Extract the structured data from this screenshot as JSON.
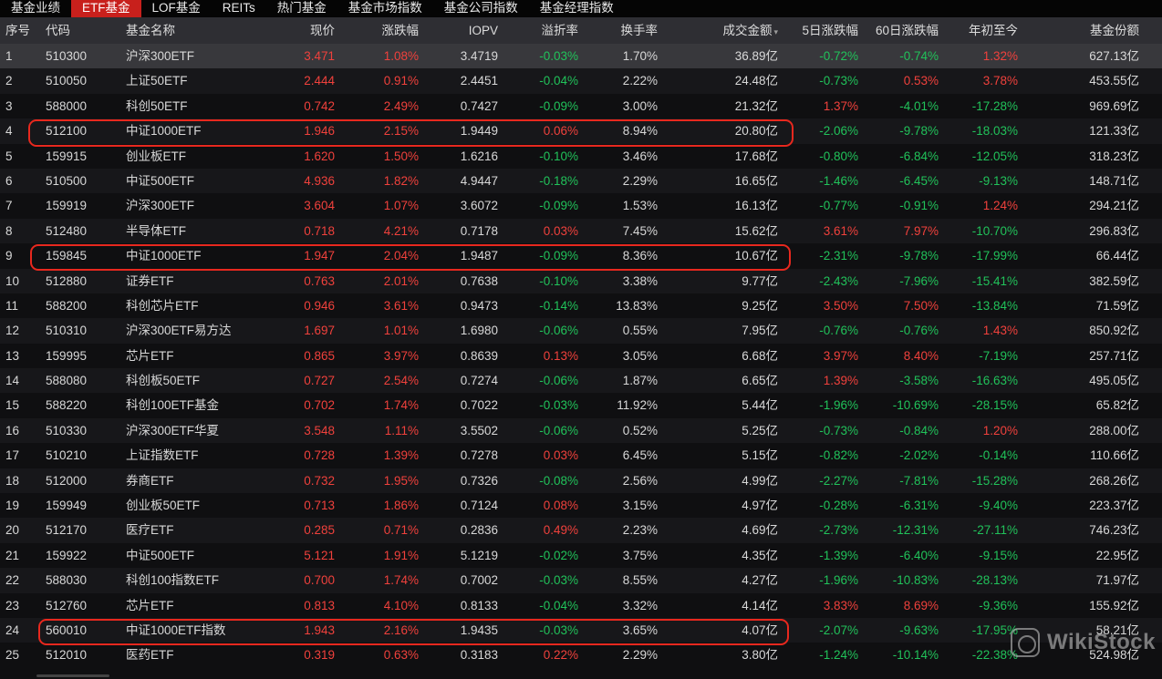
{
  "tabs": [
    "基金业绩",
    "ETF基金",
    "LOF基金",
    "REITs",
    "热门基金",
    "基金市场指数",
    "基金公司指数",
    "基金经理指数"
  ],
  "active_tab": 1,
  "columns": {
    "idx": "序号",
    "code": "代码",
    "name": "基金名称",
    "price": "现价",
    "chg": "涨跌幅",
    "iopv": "IOPV",
    "prem": "溢折率",
    "turn": "换手率",
    "amt": "成交金额",
    "d5": "5日涨跌幅",
    "d60": "60日涨跌幅",
    "ytd": "年初至今",
    "shr": "基金份额"
  },
  "rows": [
    [
      "1",
      "510300",
      "沪深300ETF",
      "3.471",
      "1.08%",
      "3.4719",
      "-0.03%",
      "1.70%",
      "36.89亿",
      "-0.72%",
      "-0.74%",
      "1.32%",
      "627.13亿"
    ],
    [
      "2",
      "510050",
      "上证50ETF",
      "2.444",
      "0.91%",
      "2.4451",
      "-0.04%",
      "2.22%",
      "24.48亿",
      "-0.73%",
      "0.53%",
      "3.78%",
      "453.55亿"
    ],
    [
      "3",
      "588000",
      "科创50ETF",
      "0.742",
      "2.49%",
      "0.7427",
      "-0.09%",
      "3.00%",
      "21.32亿",
      "1.37%",
      "-4.01%",
      "-17.28%",
      "969.69亿"
    ],
    [
      "4",
      "512100",
      "中证1000ETF",
      "1.946",
      "2.15%",
      "1.9449",
      "0.06%",
      "8.94%",
      "20.80亿",
      "-2.06%",
      "-9.78%",
      "-18.03%",
      "121.33亿"
    ],
    [
      "5",
      "159915",
      "创业板ETF",
      "1.620",
      "1.50%",
      "1.6216",
      "-0.10%",
      "3.46%",
      "17.68亿",
      "-0.80%",
      "-6.84%",
      "-12.05%",
      "318.23亿"
    ],
    [
      "6",
      "510500",
      "中证500ETF",
      "4.936",
      "1.82%",
      "4.9447",
      "-0.18%",
      "2.29%",
      "16.65亿",
      "-1.46%",
      "-6.45%",
      "-9.13%",
      "148.71亿"
    ],
    [
      "7",
      "159919",
      "沪深300ETF",
      "3.604",
      "1.07%",
      "3.6072",
      "-0.09%",
      "1.53%",
      "16.13亿",
      "-0.77%",
      "-0.91%",
      "1.24%",
      "294.21亿"
    ],
    [
      "8",
      "512480",
      "半导体ETF",
      "0.718",
      "4.21%",
      "0.7178",
      "0.03%",
      "7.45%",
      "15.62亿",
      "3.61%",
      "7.97%",
      "-10.70%",
      "296.83亿"
    ],
    [
      "9",
      "159845",
      "中证1000ETF",
      "1.947",
      "2.04%",
      "1.9487",
      "-0.09%",
      "8.36%",
      "10.67亿",
      "-2.31%",
      "-9.78%",
      "-17.99%",
      "66.44亿"
    ],
    [
      "10",
      "512880",
      "证券ETF",
      "0.763",
      "2.01%",
      "0.7638",
      "-0.10%",
      "3.38%",
      "9.77亿",
      "-2.43%",
      "-7.96%",
      "-15.41%",
      "382.59亿"
    ],
    [
      "11",
      "588200",
      "科创芯片ETF",
      "0.946",
      "3.61%",
      "0.9473",
      "-0.14%",
      "13.83%",
      "9.25亿",
      "3.50%",
      "7.50%",
      "-13.84%",
      "71.59亿"
    ],
    [
      "12",
      "510310",
      "沪深300ETF易方达",
      "1.697",
      "1.01%",
      "1.6980",
      "-0.06%",
      "0.55%",
      "7.95亿",
      "-0.76%",
      "-0.76%",
      "1.43%",
      "850.92亿"
    ],
    [
      "13",
      "159995",
      "芯片ETF",
      "0.865",
      "3.97%",
      "0.8639",
      "0.13%",
      "3.05%",
      "6.68亿",
      "3.97%",
      "8.40%",
      "-7.19%",
      "257.71亿"
    ],
    [
      "14",
      "588080",
      "科创板50ETF",
      "0.727",
      "2.54%",
      "0.7274",
      "-0.06%",
      "1.87%",
      "6.65亿",
      "1.39%",
      "-3.58%",
      "-16.63%",
      "495.05亿"
    ],
    [
      "15",
      "588220",
      "科创100ETF基金",
      "0.702",
      "1.74%",
      "0.7022",
      "-0.03%",
      "11.92%",
      "5.44亿",
      "-1.96%",
      "-10.69%",
      "-28.15%",
      "65.82亿"
    ],
    [
      "16",
      "510330",
      "沪深300ETF华夏",
      "3.548",
      "1.11%",
      "3.5502",
      "-0.06%",
      "0.52%",
      "5.25亿",
      "-0.73%",
      "-0.84%",
      "1.20%",
      "288.00亿"
    ],
    [
      "17",
      "510210",
      "上证指数ETF",
      "0.728",
      "1.39%",
      "0.7278",
      "0.03%",
      "6.45%",
      "5.15亿",
      "-0.82%",
      "-2.02%",
      "-0.14%",
      "110.66亿"
    ],
    [
      "18",
      "512000",
      "券商ETF",
      "0.732",
      "1.95%",
      "0.7326",
      "-0.08%",
      "2.56%",
      "4.99亿",
      "-2.27%",
      "-7.81%",
      "-15.28%",
      "268.26亿"
    ],
    [
      "19",
      "159949",
      "创业板50ETF",
      "0.713",
      "1.86%",
      "0.7124",
      "0.08%",
      "3.15%",
      "4.97亿",
      "-0.28%",
      "-6.31%",
      "-9.40%",
      "223.37亿"
    ],
    [
      "20",
      "512170",
      "医疗ETF",
      "0.285",
      "0.71%",
      "0.2836",
      "0.49%",
      "2.23%",
      "4.69亿",
      "-2.73%",
      "-12.31%",
      "-27.11%",
      "746.23亿"
    ],
    [
      "21",
      "159922",
      "中证500ETF",
      "5.121",
      "1.91%",
      "5.1219",
      "-0.02%",
      "3.75%",
      "4.35亿",
      "-1.39%",
      "-6.40%",
      "-9.15%",
      "22.95亿"
    ],
    [
      "22",
      "588030",
      "科创100指数ETF",
      "0.700",
      "1.74%",
      "0.7002",
      "-0.03%",
      "8.55%",
      "4.27亿",
      "-1.96%",
      "-10.83%",
      "-28.13%",
      "71.97亿"
    ],
    [
      "23",
      "512760",
      "芯片ETF",
      "0.813",
      "4.10%",
      "0.8133",
      "-0.04%",
      "3.32%",
      "4.14亿",
      "3.83%",
      "8.69%",
      "-9.36%",
      "155.92亿"
    ],
    [
      "24",
      "560010",
      "中证1000ETF指数",
      "1.943",
      "2.16%",
      "1.9435",
      "-0.03%",
      "3.65%",
      "4.07亿",
      "-2.07%",
      "-9.63%",
      "-17.95%",
      "58.21亿"
    ],
    [
      "25",
      "512010",
      "医药ETF",
      "0.319",
      "0.63%",
      "0.3183",
      "0.22%",
      "2.29%",
      "3.80亿",
      "-1.24%",
      "-10.14%",
      "-22.38%",
      "524.98亿"
    ]
  ],
  "selected_row": 0,
  "highlighted_rows": [
    3,
    8,
    23
  ],
  "sort_icon": "sort-desc-icon",
  "watermark": "WikiStock",
  "colors": {
    "up": "#f0413c",
    "down": "#21c25a",
    "active_tab": "#c8201c",
    "highlight_box": "#e8281e"
  }
}
